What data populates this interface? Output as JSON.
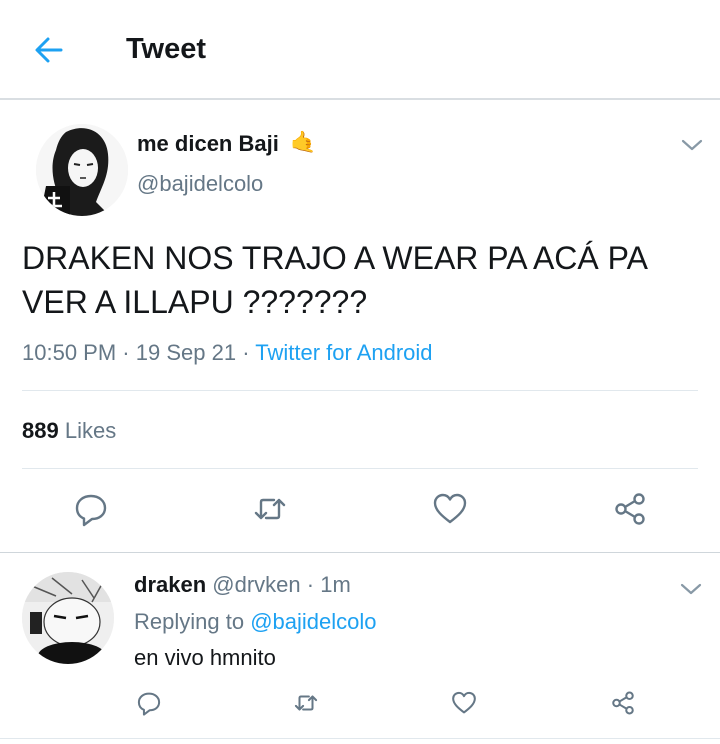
{
  "colors": {
    "accent": "#1da1f2",
    "secondary_text": "#657786",
    "primary_text": "#14171a"
  },
  "header": {
    "title": "Tweet",
    "back_icon": "arrow-left-icon"
  },
  "tweet": {
    "display_name": "me dicen Baji",
    "name_emoji": "🤙",
    "handle": "@bajidelcolo",
    "text": "DRAKEN NOS TRAJO A WEAR PA ACÁ PA VER A ILLAPU ???????",
    "time": "10:50 PM",
    "separator": "·",
    "date": "19 Sep 21",
    "source": "Twitter for Android",
    "likes_count": "889",
    "likes_label": "Likes",
    "actions": [
      "reply-icon",
      "retweet-icon",
      "like-icon",
      "share-icon"
    ]
  },
  "reply": {
    "display_name": "draken",
    "handle": "@drvken",
    "separator": "·",
    "time": "1m",
    "replying_label": "Replying to",
    "replying_handle": "@bajidelcolo",
    "text": "en vivo hmnito"
  }
}
